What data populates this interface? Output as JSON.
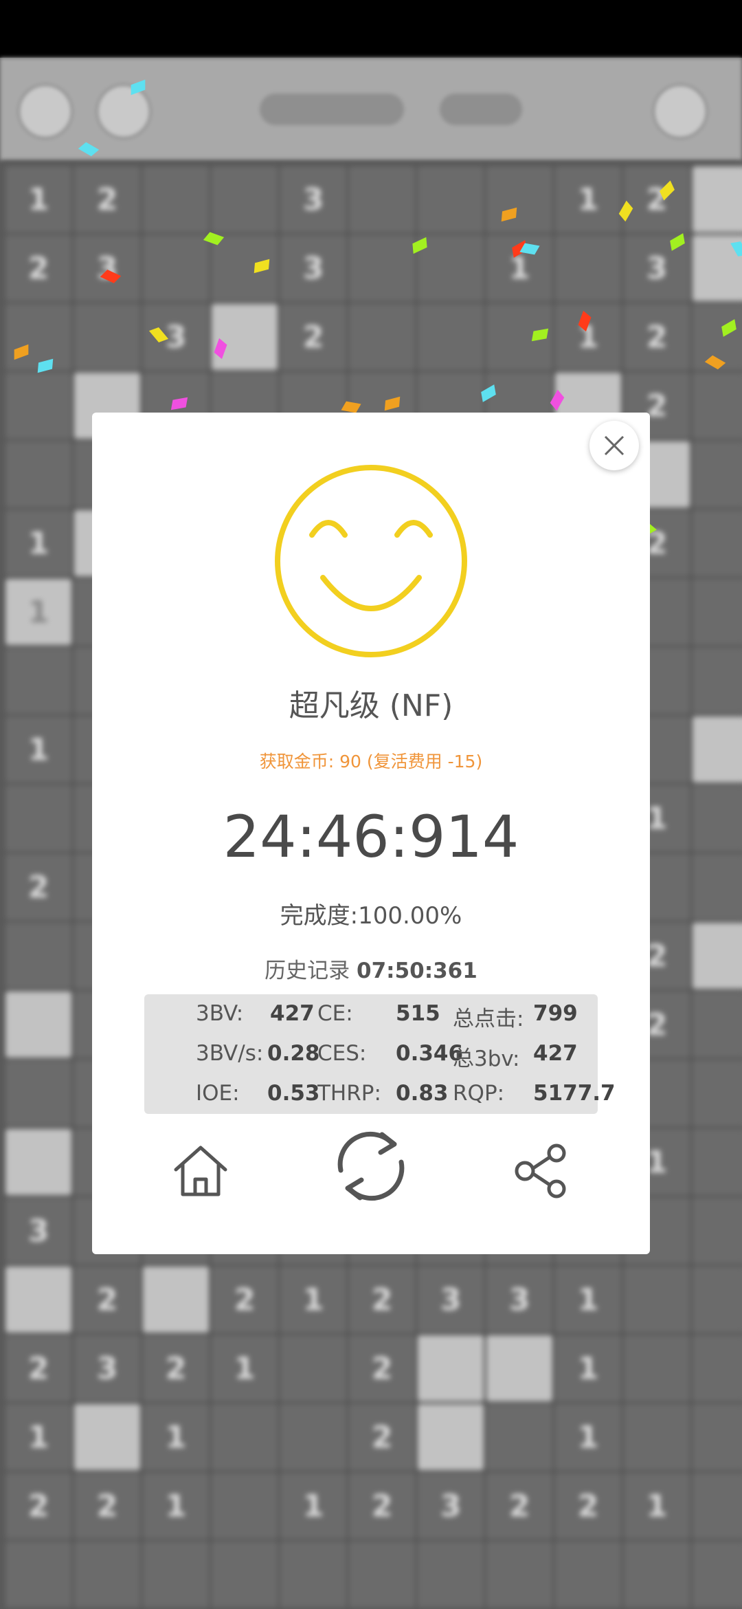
{
  "result": {
    "rank": "超凡级 (NF)",
    "coins_text": "获取金币: 90 (复活费用 -15)",
    "time": "24:46:914",
    "completion_label": "完成度:",
    "completion_value": "100.00%",
    "history_label": "历史记录",
    "history_time": "07:50:361"
  },
  "stats": {
    "row1": [
      {
        "label": "3BV:",
        "value": "427"
      },
      {
        "label": "CE:",
        "value": "515"
      },
      {
        "label": "总点击:",
        "value": "799"
      }
    ],
    "row2": [
      {
        "label": "3BV/s:",
        "value": "0.28"
      },
      {
        "label": "CES:",
        "value": "0.346"
      },
      {
        "label": "总3bv:",
        "value": "427"
      }
    ],
    "row3": [
      {
        "label": "IOE:",
        "value": "0.53"
      },
      {
        "label": "THRP:",
        "value": "0.83"
      },
      {
        "label": "RQP:",
        "value": "5177.7"
      }
    ]
  },
  "icons": {
    "close": "close-icon",
    "smiley": "smiley-face-icon",
    "home": "home-icon",
    "restart": "restart-icon",
    "share": "share-icon"
  },
  "colors": {
    "smiley": "#f2cf1f",
    "coins": "#f0953a",
    "dialog_bg": "#ffffff",
    "stats_bg": "#e2e2e2"
  },
  "board": {
    "rows": [
      [
        "1",
        "2",
        "",
        "",
        "3",
        "",
        "",
        "",
        "1",
        "2",
        ""
      ],
      [
        "2",
        "3",
        "",
        "",
        "3",
        "",
        "",
        "1",
        "",
        "3",
        ""
      ],
      [
        "",
        "",
        "3",
        "",
        "2",
        "",
        "",
        "",
        "1",
        "2",
        ""
      ],
      [
        "",
        "",
        "",
        "",
        "",
        "",
        "",
        "",
        "",
        "2",
        ""
      ],
      [
        "",
        "",
        "",
        "",
        "",
        "",
        "",
        "",
        "",
        "",
        ""
      ],
      [
        "1",
        "",
        "",
        "",
        "",
        "",
        "",
        "",
        "",
        "2",
        ""
      ],
      [
        "1",
        "",
        "",
        "",
        "",
        "",
        "",
        "",
        "",
        "",
        ""
      ],
      [
        "",
        "",
        "",
        "",
        "",
        "",
        "",
        "",
        "",
        "",
        ""
      ],
      [
        "1",
        "",
        "",
        "",
        "",
        "",
        "",
        "",
        "",
        "",
        ""
      ],
      [
        "",
        "",
        "",
        "",
        "",
        "",
        "",
        "",
        "",
        "1",
        ""
      ],
      [
        "2",
        "",
        "",
        "",
        "",
        "",
        "",
        "",
        "",
        "",
        ""
      ],
      [
        "",
        "",
        "",
        "",
        "",
        "",
        "",
        "",
        "",
        "2",
        ""
      ],
      [
        "",
        "",
        "",
        "",
        "",
        "",
        "",
        "",
        "",
        "2",
        ""
      ],
      [
        "",
        "",
        "",
        "",
        "",
        "",
        "",
        "",
        "",
        "",
        ""
      ],
      [
        "",
        "",
        "",
        "",
        "",
        "",
        "",
        "",
        "",
        "1",
        ""
      ],
      [
        "3",
        "",
        "",
        "",
        "",
        "",
        "",
        "",
        "",
        "",
        ""
      ],
      [
        "",
        "2",
        "",
        "2",
        "1",
        "2",
        "3",
        "3",
        "1",
        "",
        ""
      ],
      [
        "2",
        "3",
        "2",
        "1",
        "",
        "2",
        "",
        "",
        "1",
        "",
        ""
      ],
      [
        "1",
        "",
        "1",
        "",
        "",
        "2",
        "",
        "",
        "1",
        "",
        ""
      ],
      [
        "2",
        "2",
        "1",
        "",
        "1",
        "2",
        "3",
        "2",
        "2",
        "1",
        ""
      ],
      [
        "",
        "",
        "",
        "",
        "",
        "",
        "",
        "",
        "",
        "",
        ""
      ]
    ]
  }
}
